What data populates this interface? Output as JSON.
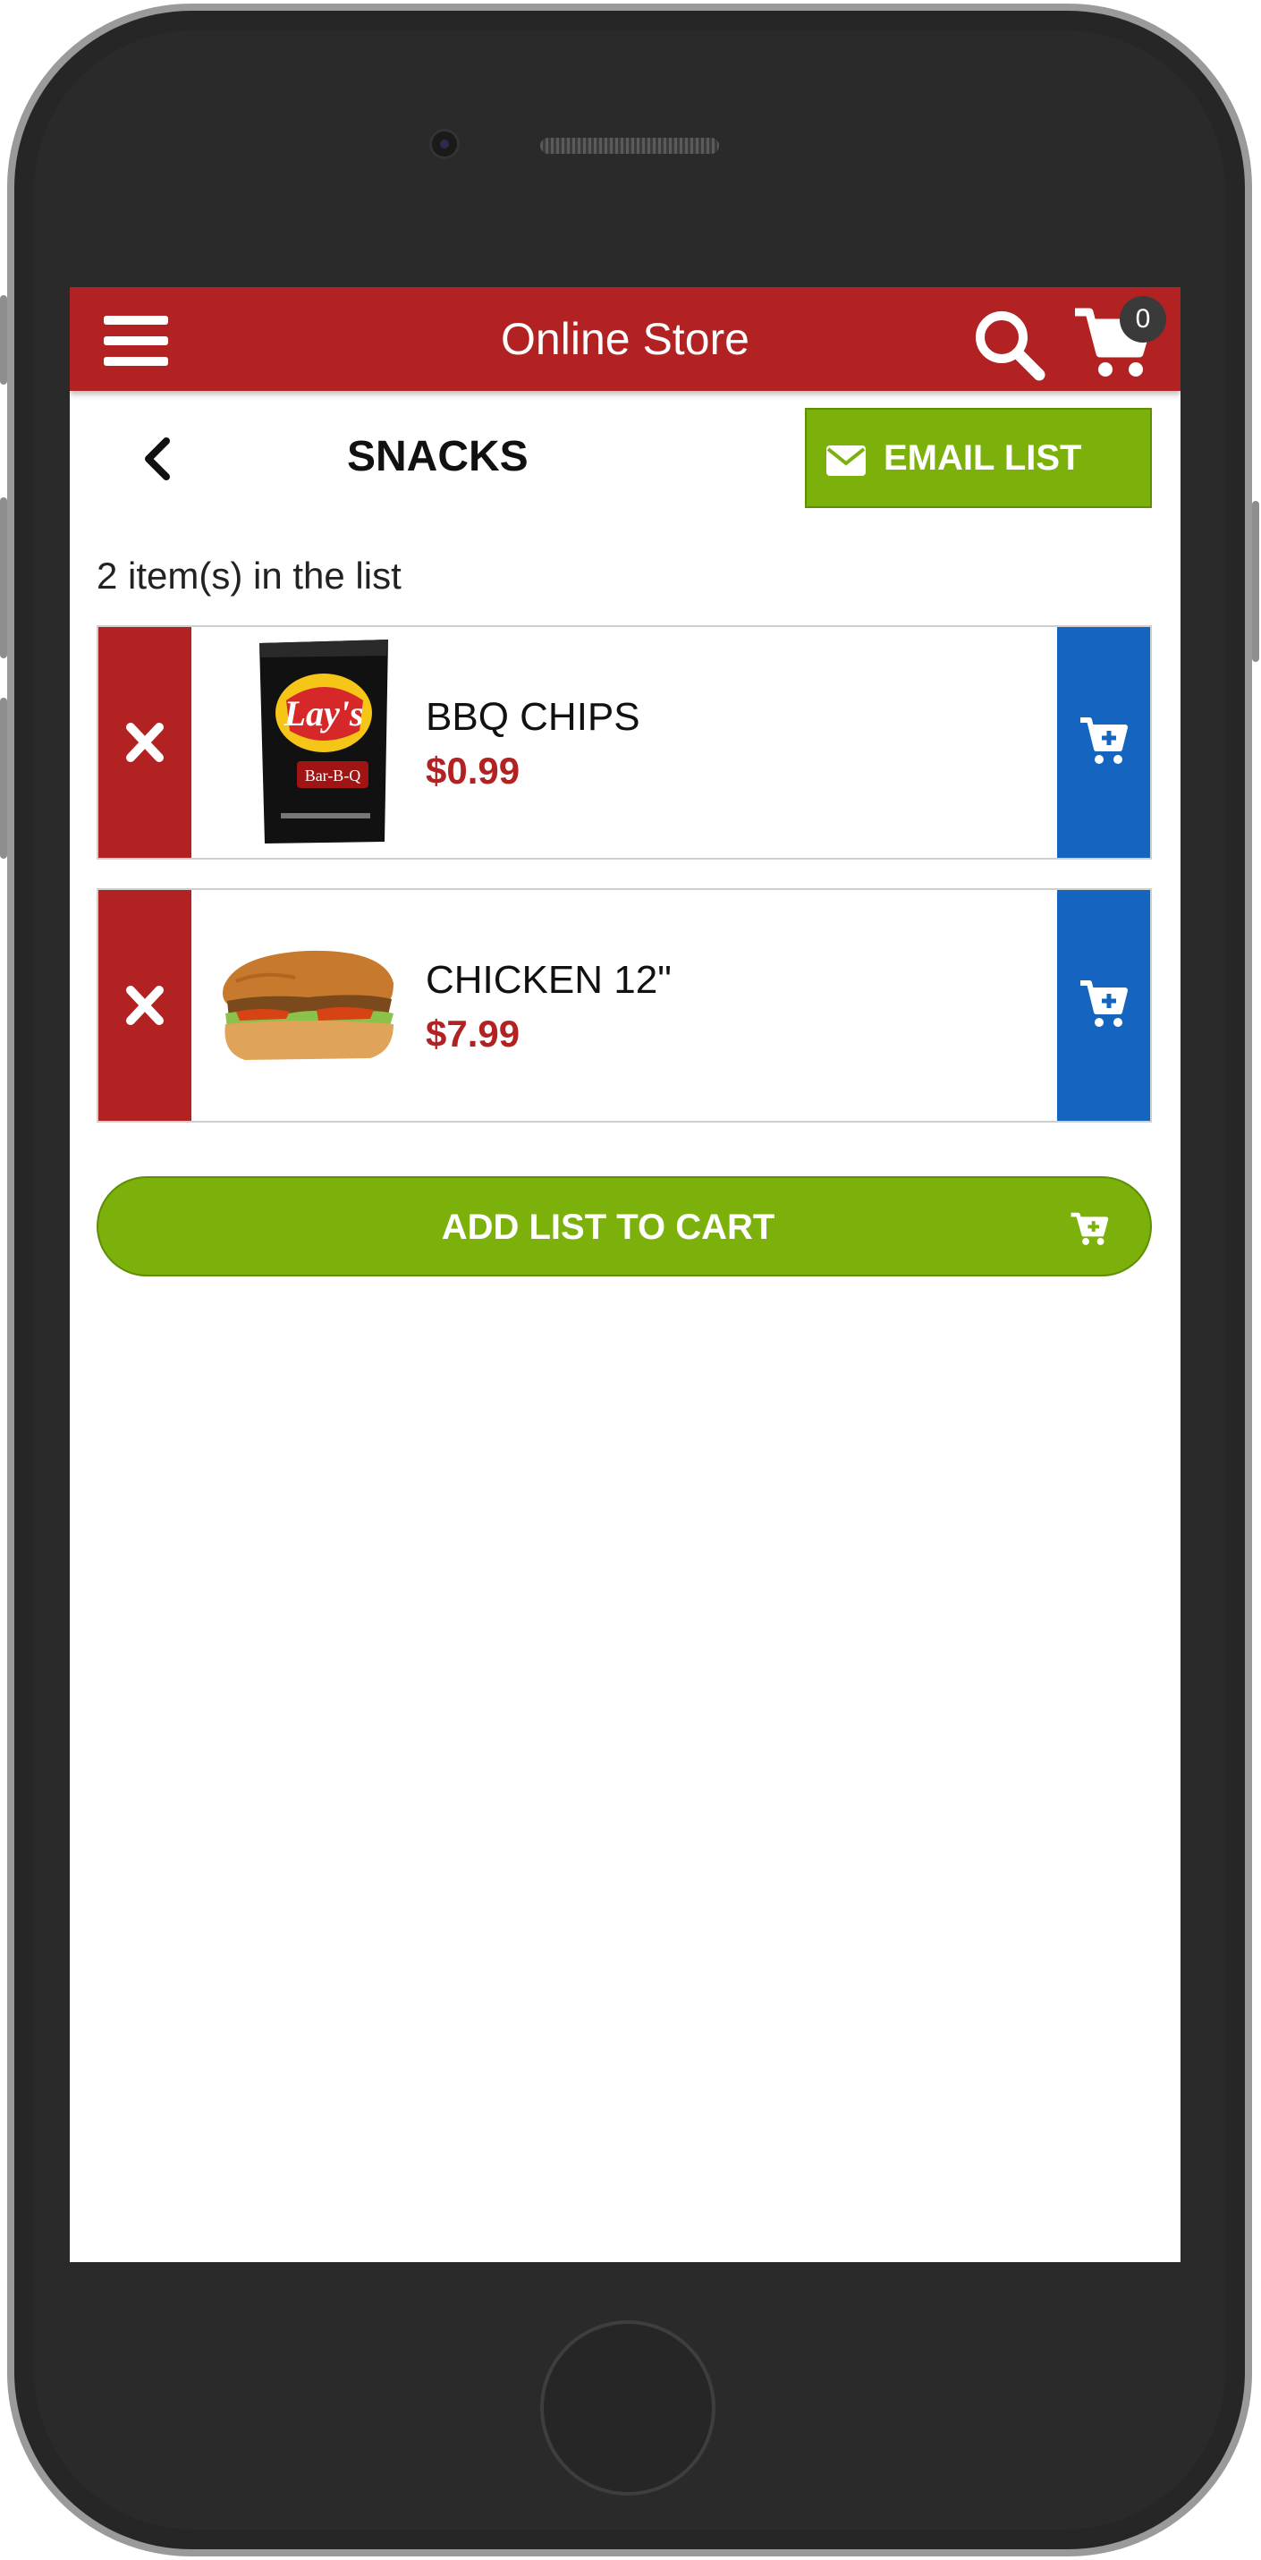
{
  "app": {
    "title": "Online Store",
    "cart_count": "0",
    "icons": {
      "menu": "hamburger-menu-icon",
      "search": "search-icon",
      "cart": "shopping-cart-icon"
    }
  },
  "list": {
    "title": "SNACKS",
    "email_label": "EMAIL LIST",
    "count_text": "2 item(s) in the list",
    "items": [
      {
        "name": "BBQ CHIPS",
        "price": "$0.99",
        "thumb_brand": "Lay's",
        "thumb_flavor": "Bar-B-Q"
      },
      {
        "name": "CHICKEN 12\"",
        "price": "$7.99"
      }
    ],
    "add_all_label": "ADD LIST TO CART"
  },
  "colors": {
    "brand_red": "#b22222",
    "action_green": "#7cb00a",
    "cart_blue": "#1565c0"
  }
}
